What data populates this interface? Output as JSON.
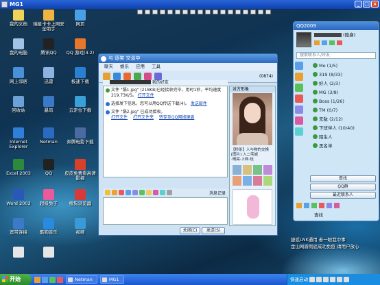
{
  "outer_window": {
    "title": "MG1"
  },
  "desktop_icons": [
    {
      "label": "我的文档",
      "color": "#f2d35a"
    },
    {
      "label": "瑞星卡卡上网安全助手",
      "color": "#f0b440"
    },
    {
      "label": "网页",
      "color": "#4aa0e8"
    },
    {
      "label": "我的电脑",
      "color": "#9fc3e6"
    },
    {
      "label": "腾讯QQ",
      "color": "#222222"
    },
    {
      "label": "QQ 游戏(4.2)",
      "color": "#e8762b"
    },
    {
      "label": "网上邻居",
      "color": "#4a90d8"
    },
    {
      "label": "迅雷",
      "color": "#8db4e0"
    },
    {
      "label": "极速下载",
      "color": "#2a7fd0"
    },
    {
      "label": "回收站",
      "color": "#6aa2d8"
    },
    {
      "label": "暴风",
      "color": "#3a78c8"
    },
    {
      "label": "云定位下载",
      "color": "#3aa0d8"
    },
    {
      "label": "Internet Explorer",
      "color": "#2f7ed8"
    },
    {
      "label": "Netman",
      "color": "#2a6ac0"
    },
    {
      "label": "奔腾电影下载",
      "color": "#4a6aa0"
    },
    {
      "label": "Excel 2003",
      "color": "#2d8a3a"
    },
    {
      "label": "QQ",
      "color": "#222222"
    },
    {
      "label": "皮皮免费看高清影视",
      "color": "#d8402a"
    },
    {
      "label": "Word 2003",
      "color": "#2a58b8"
    },
    {
      "label": "超级兔子",
      "color": "#e85a9a"
    },
    {
      "label": "搜狗浏览器",
      "color": "#d83a3a"
    },
    {
      "label": "宽带连接",
      "color": "#3a7ac8"
    },
    {
      "label": "酷狗音乐",
      "color": "#2a8ae0"
    },
    {
      "label": "视频",
      "color": "#3a9ad8"
    },
    {
      "label": "",
      "color": "#e6e6e6"
    },
    {
      "label": "",
      "color": "#e6e6e6"
    }
  ],
  "chat": {
    "title": "与 逐笑 交谈中",
    "menu": [
      "聊天",
      "娱乐",
      "应用",
      "工具"
    ],
    "status_right": "(0874)",
    "contact_header": "我的好友",
    "side_title": "对方形象",
    "message1_prefix": "文件 \"锅1.jpg\" (218KB)已经接收完毕，用时1秒，平均速度 219.73K/S。",
    "message1_link": "打开文件",
    "message2": "选择发下信息，您可以用QQ传送下载(4)。",
    "message2_link": "发送邮件",
    "message3": "文件 \"锅2.jpg\" 已成功接收。",
    "message3_links": [
      "打开文件",
      "打开文件夹",
      "转存至QQ网络硬盘"
    ],
    "ad_text": "【秒杀】人与物的交换",
    "ad_sub": "[图片]  入二宅城",
    "ad_sub2": "·晴亮·上档·玩",
    "bottom_link": "消息记录",
    "send_button": "发送(S)",
    "close_button": "关闭(C)",
    "history_button": "消息记录"
  },
  "qq_panel": {
    "title": "QQ2009",
    "nickname": "(隐身)",
    "search_placeholder": "搜索联系人/好友",
    "groups": [
      "Me (1/5)",
      "319 (8/33)",
      "好人 (2/3)",
      "MG (3/8)",
      "Boss (1/26)",
      "TM (0/7)",
      "无敌 (2/12)",
      "下班伴人 (10/40)",
      "陌生人",
      "黑名单"
    ],
    "buttons": [
      "查找",
      "QQ群",
      "最近联系人"
    ],
    "bottom_label": "查找"
  },
  "overlay_text": {
    "line1": "捷贰LNK通用 者一眼我中事",
    "line2": "金山网盾彻底成功免疫  请用户放心"
  },
  "taskbar": {
    "start": "开始",
    "tasks": [
      "Netman",
      "MG1"
    ],
    "tray_text": "快速启动"
  }
}
